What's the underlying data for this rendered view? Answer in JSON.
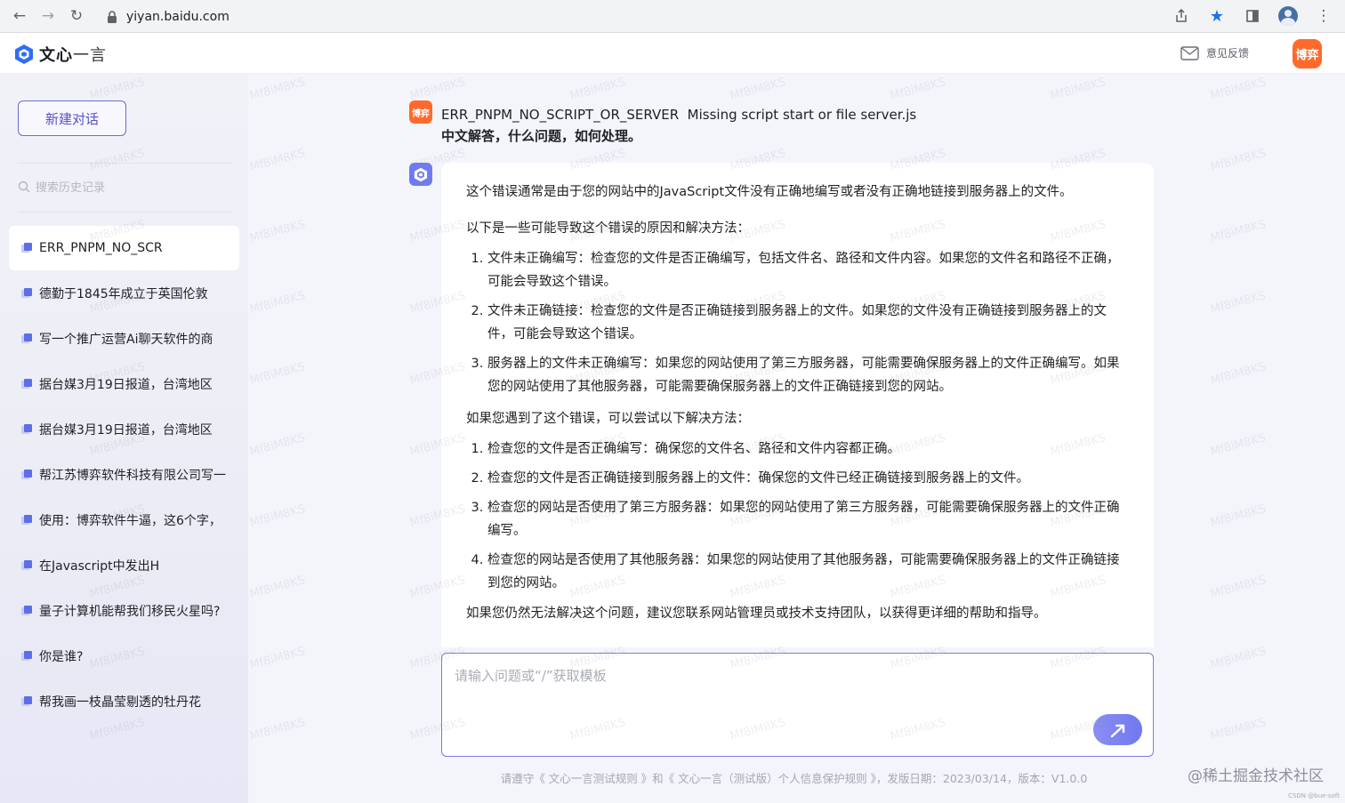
{
  "browser": {
    "url": "yiyan.baidu.com"
  },
  "header": {
    "logo_main": "文心",
    "logo_sub": "一言",
    "feedback_label": "意见反馈",
    "user_badge": "博弈"
  },
  "sidebar": {
    "new_chat_label": "新建对话",
    "search_placeholder": "搜索历史记录",
    "items": [
      {
        "label": "ERR_PNPM_NO_SCR"
      },
      {
        "label": "德勤于1845年成立于英国伦敦"
      },
      {
        "label": "写一个推广运营Ai聊天软件的商"
      },
      {
        "label": "据台媒3月19日报道，台湾地区"
      },
      {
        "label": "据台媒3月19日报道，台湾地区"
      },
      {
        "label": "帮江苏博弈软件科技有限公司写一"
      },
      {
        "label": "使用：博弈软件牛逼，这6个字，"
      },
      {
        "label": "在Javascript中发出H"
      },
      {
        "label": "量子计算机能帮我们移民火星吗?"
      },
      {
        "label": "你是谁?"
      },
      {
        "label": "帮我画一枝晶莹剔透的牡丹花"
      }
    ]
  },
  "conversation": {
    "question_avatar": "博弈",
    "question_line1": "ERR_PNPM_NO_SCRIPT_OR_SERVER  Missing script start or file server.js",
    "question_line2": "中文解答，什么问题，如何处理。",
    "answer": {
      "intro": "这个错误通常是由于您的网站中的JavaScript文件没有正确地编写或者没有正确地链接到服务器上的文件。",
      "causes_title": "以下是一些可能导致这个错误的原因和解决方法：",
      "causes": [
        "文件未正确编写：检查您的文件是否正确编写，包括文件名、路径和文件内容。如果您的文件名和路径不正确，可能会导致这个错误。",
        "文件未正确链接：检查您的文件是否正确链接到服务器上的文件。如果您的文件没有正确链接到服务器上的文件，可能会导致这个错误。",
        "服务器上的文件未正确编写：如果您的网站使用了第三方服务器，可能需要确保服务器上的文件正确编写。如果您的网站使用了其他服务器，可能需要确保服务器上的文件正确链接到您的网站。"
      ],
      "solutions_title": "如果您遇到了这个错误，可以尝试以下解决方法：",
      "solutions": [
        "检查您的文件是否正确编写：确保您的文件名、路径和文件内容都正确。",
        "检查您的文件是否正确链接到服务器上的文件：确保您的文件已经正确链接到服务器上的文件。",
        "检查您的网站是否使用了第三方服务器：如果您的网站使用了第三方服务器，可能需要确保服务器上的文件正确编写。",
        "检查您的网站是否使用了其他服务器：如果您的网站使用了其他服务器，可能需要确保服务器上的文件正确链接到您的网站。"
      ],
      "closing": "如果您仍然无法解决这个问题，建议您联系网站管理员或技术支持团队，以获得更详细的帮助和指导。"
    }
  },
  "input": {
    "placeholder": "请输入问题或“/”获取模板"
  },
  "footer": {
    "text": "请遵守《 文心一言测试规则 》和《 文心一言（测试版）个人信息保护规则 》，发版日期：2023/03/14，版本：V1.0.0"
  },
  "corner": {
    "mark": "@稀土掘金技术社区",
    "small": "CSDN @bue-soft"
  },
  "watermark": "Mf8iM8KS",
  "colors": {
    "accent": "#6d6ad6",
    "user_badge": "#ff6a2c",
    "bot_avatar": "#6e7cf0"
  }
}
